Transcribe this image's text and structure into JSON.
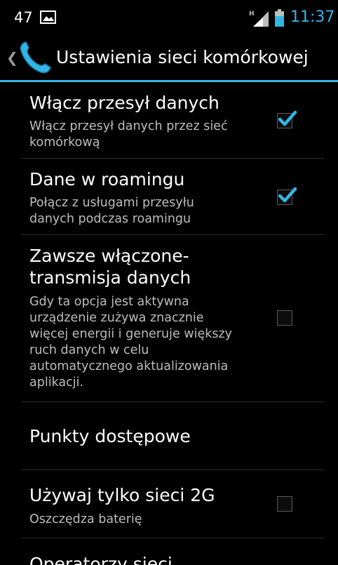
{
  "status_bar": {
    "notification_count": "47",
    "notification_icon": "image-icon",
    "signal_icon": "signal-h-icon",
    "battery_icon": "battery-icon",
    "time": "11:37",
    "accent_color": "#33b5e5"
  },
  "action_bar": {
    "up_icon": "chevron-left-icon",
    "app_icon": "phone-icon",
    "title": "Ustawienia sieci komórkowej"
  },
  "preferences": [
    {
      "title": "Włącz przesył danych",
      "summary_lines": [
        "Włącz przesył danych przez sieć",
        "komórkową"
      ],
      "checked": true
    },
    {
      "title": "Dane w roamingu",
      "summary_lines": [
        "Połącz z usługami przesyłu",
        "danych podczas roamingu"
      ],
      "checked": true
    },
    {
      "title_lines": [
        "Zawsze włączone-",
        "transmisja danych"
      ],
      "summary_lines": [
        "Gdy ta opcja jest aktywna",
        "urządzenie zużywa znacznie",
        "więcej energii i generuje większy",
        "ruch danych w celu",
        "automatycznego aktualizowania",
        "aplikacji."
      ],
      "checked": false
    },
    {
      "title": "Punkty dostępowe"
    },
    {
      "title": "Używaj tylko sieci 2G",
      "summary_lines": [
        "Oszczędza baterię"
      ],
      "checked": false
    },
    {
      "title": "Operatorzy sieci"
    }
  ]
}
